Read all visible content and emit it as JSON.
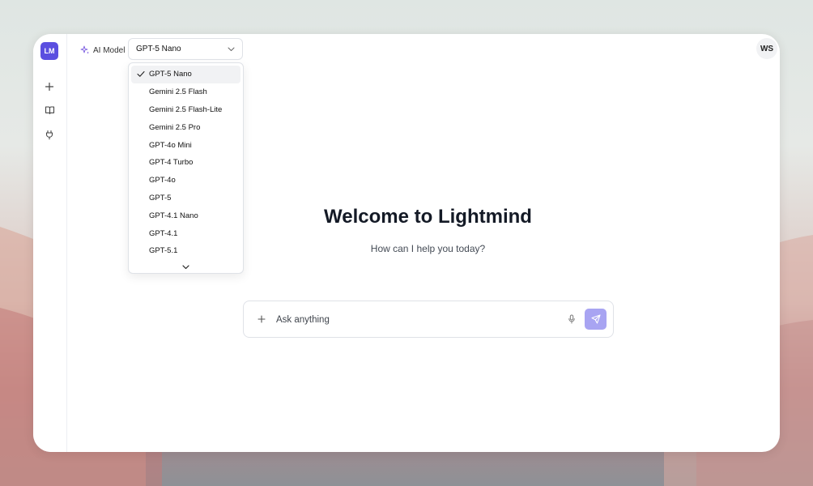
{
  "app": {
    "logo_text": "LM"
  },
  "sidebar": {
    "items": [
      {
        "name": "new-chat",
        "icon": "plus-icon"
      },
      {
        "name": "library",
        "icon": "book-icon"
      },
      {
        "name": "plugins",
        "icon": "plug-icon"
      }
    ]
  },
  "header": {
    "model_label": "AI Model",
    "selected_model": "GPT-5 Nano",
    "user_initials": "WS"
  },
  "dropdown": {
    "options": [
      "GPT-5 Nano",
      "Gemini 2.5 Flash",
      "Gemini 2.5 Flash-Lite",
      "Gemini 2.5 Pro",
      "GPT-4o Mini",
      "GPT-4 Turbo",
      "GPT-4o",
      "GPT-5",
      "GPT-4.1 Nano",
      "GPT-4.1",
      "GPT-5.1"
    ],
    "selected_index": 0
  },
  "main": {
    "title": "Welcome to Lightmind",
    "subtitle": "How can I help you today?"
  },
  "composer": {
    "placeholder": "Ask anything",
    "value": ""
  },
  "colors": {
    "accent": "#5b4fe0",
    "send_button": "#a8a4f2"
  }
}
